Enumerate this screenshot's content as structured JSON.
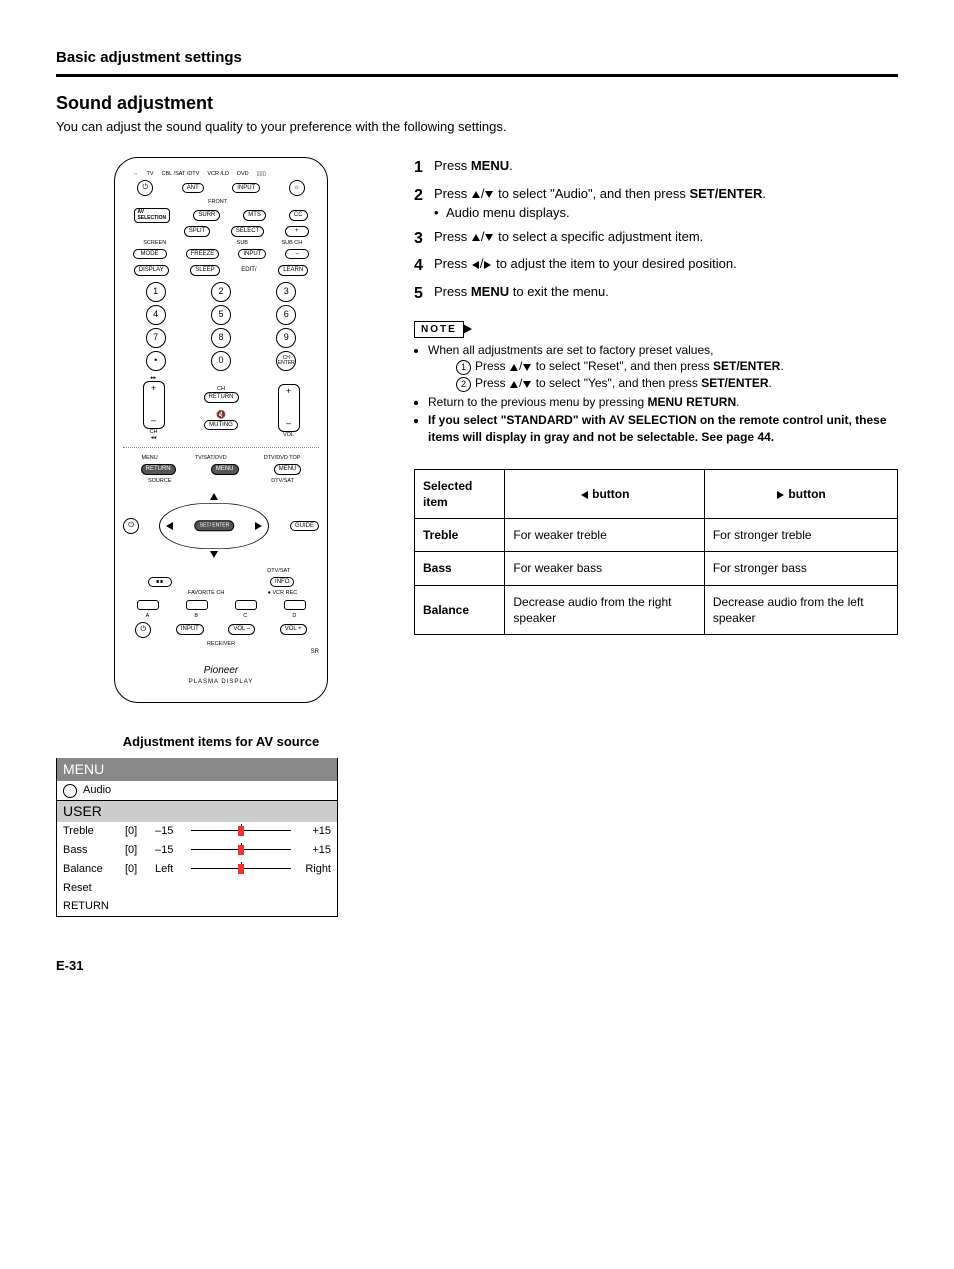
{
  "section_title": "Basic adjustment settings",
  "heading": "Sound adjustment",
  "intro": "You can adjust the sound quality to your preference with the following settings.",
  "remote": {
    "top_labels": [
      "TV",
      "CBL /SAT /DTV",
      "VCR /LD",
      "DVD"
    ],
    "row1": {
      "ant": "ANT",
      "input": "INPUT"
    },
    "row2": {
      "av_sel_label": "AV SELECTION",
      "front": "FRONT",
      "surr": "SURR",
      "mts": "MTS",
      "cc": "CC"
    },
    "row3": {
      "split": "SPLIT",
      "select": "SELECT",
      "plus": "+"
    },
    "row4": {
      "screen": "SCREEN",
      "mode": "MODE",
      "freeze": "FREEZE",
      "sub": "SUB",
      "input2": "INPUT",
      "subch": "SUB CH",
      "minus": "–"
    },
    "row5": {
      "display": "DISPLAY",
      "sleep": "SLEEP",
      "edit": "EDIT/",
      "learn": "LEARN"
    },
    "digits": [
      "1",
      "2",
      "3",
      "4",
      "5",
      "6",
      "7",
      "8",
      "9",
      "•",
      "0"
    ],
    "chenter": "CH ENTER",
    "ch_label": "CH",
    "return_label": "RETURN",
    "vol_label": "VOL",
    "ch_small": "CH",
    "muting": "MUTING",
    "menu_return": "RETURN",
    "menu_label": "MENU",
    "tvsatdvd": "TV/SAT/DVD",
    "dtvdvdtop": "DTV/DVD TOP",
    "menu2": "MENU",
    "source": "SOURCE",
    "dtvsat": "DTV/SAT",
    "guide": "GUIDE",
    "setenter": "SET/ ENTER",
    "info": "INFO",
    "favorite": "FAVORITE CH",
    "vcrrec": "VCR REC",
    "letters": [
      "A",
      "B",
      "C",
      "D"
    ],
    "receiver_row": {
      "input": "INPUT",
      "volminus": "VOL –",
      "volplus": "VOL +",
      "receiver": "RECEIVER"
    },
    "brand": "Pioneer",
    "brand_sub": "PLASMA DISPLAY"
  },
  "steps": [
    {
      "n": "1",
      "pre": "Press ",
      "b1": "MENU",
      "post": "."
    },
    {
      "n": "2",
      "pre": "Press ",
      "arrows": "ud",
      "mid": " to select \"Audio\", and then press ",
      "b1": "SET/ENTER",
      "post": ".",
      "sub": "Audio menu displays."
    },
    {
      "n": "3",
      "pre": "Press ",
      "arrows": "ud",
      "post": " to select a specific adjustment item."
    },
    {
      "n": "4",
      "pre": "Press ",
      "arrows": "lr",
      "post": " to adjust the item to your desired position."
    },
    {
      "n": "5",
      "pre": "Press ",
      "b1": "MENU",
      "post": " to exit the menu."
    }
  ],
  "note_label": "NOTE",
  "notes": {
    "line1": "When all adjustments are set to factory preset values,",
    "c1": "1",
    "c1_pre": "Press ",
    "c1_mid": " to select \"Reset\", and then press ",
    "c1_b": "SET/ENTER",
    "c1_post": ".",
    "c2": "2",
    "c2_pre": "Press ",
    "c2_mid": " to select \"Yes\", and then press ",
    "c2_b": "SET/ENTER",
    "c2_post": ".",
    "line2_pre": "Return to the previous menu by pressing ",
    "line2_b": "MENU RETURN",
    "line2_post": ".",
    "line3": "If you select \"STANDARD\" with AV SELECTION on the remote control unit, these items will display in gray and not be selectable. See page 44."
  },
  "table": {
    "h1": "Selected item",
    "h2": "button",
    "h3": "button",
    "rows": [
      {
        "item": "Treble",
        "left": "For weaker treble",
        "right": "For stronger treble"
      },
      {
        "item": "Bass",
        "left": "For weaker bass",
        "right": "For stronger bass"
      },
      {
        "item": "Balance",
        "left": "Decrease audio from the right speaker",
        "right": "Decrease audio from the left speaker"
      }
    ]
  },
  "osd_title": "Adjustment items for AV source",
  "osd": {
    "menu": "MENU",
    "audio": "Audio",
    "user": "USER",
    "rows": [
      {
        "name": "Treble",
        "cur": "[0]",
        "min": "–15",
        "max": "+15",
        "thumb": 50
      },
      {
        "name": "Bass",
        "cur": "[0]",
        "min": "–15",
        "max": "+15",
        "thumb": 50
      },
      {
        "name": "Balance",
        "cur": "[0]",
        "min": "Left",
        "max": "Right",
        "thumb": 50
      }
    ],
    "reset": "Reset",
    "return": "RETURN"
  },
  "page_num": "E-31"
}
